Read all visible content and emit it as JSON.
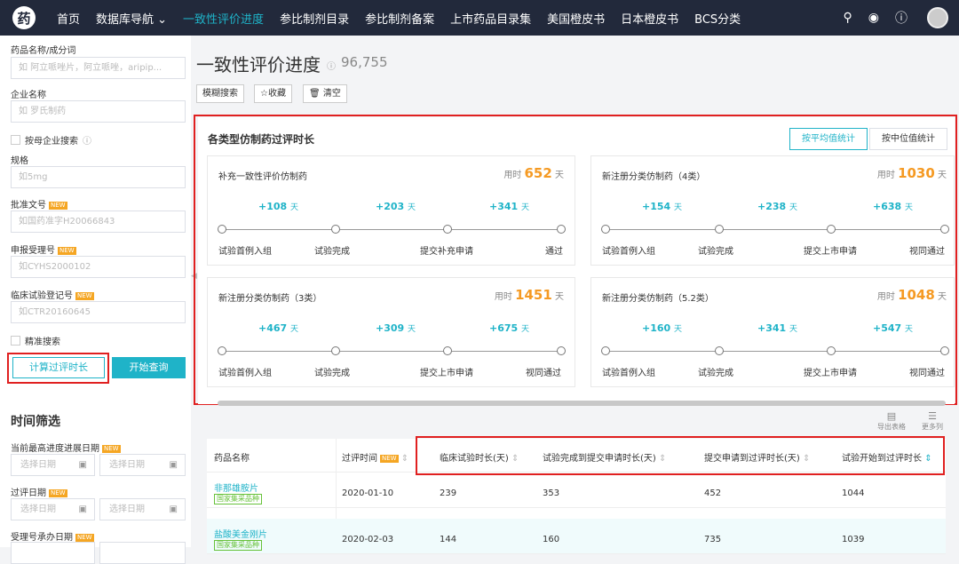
{
  "topbar": {
    "logo": "药",
    "nav": [
      "首页",
      "数据库导航 ⌄",
      "一致性评价进度",
      "参比制剂目录",
      "参比制剂备案",
      "上市药品目录集",
      "美国橙皮书",
      "日本橙皮书",
      "BCS分类"
    ],
    "active_index": 2,
    "icons": [
      "search-icon",
      "bulb-icon",
      "help-icon"
    ]
  },
  "sidebar": {
    "drug_label": "药品名称/成分词",
    "drug_placeholder": "如 阿立哌唑片，阿立哌唑，aripip...",
    "company_label": "企业名称",
    "company_placeholder": "如 罗氏制药",
    "parent_search": "按母企业搜索",
    "spec_label": "规格",
    "spec_placeholder": "如5mg",
    "approval_label": "批准文号",
    "approval_placeholder": "如国药准字H20066843",
    "apply_label": "申报受理号",
    "apply_placeholder": "如CYHS2000102",
    "trial_label": "临床试验登记号",
    "trial_placeholder": "如CTR20160645",
    "new_tag": "NEW",
    "exact_search": "精准搜索",
    "calc_button": "计算过评时长",
    "search_button": "开始查询",
    "time_filter": "时间筛选",
    "latest_date_label": "当前最高进度进展日期",
    "eval_date_label": "过评日期",
    "accept_date_label": "受理号承办日期",
    "date_placeholder": "选择日期"
  },
  "main": {
    "title": "一致性评价进度",
    "count": "96,755",
    "fuzzy": "模糊搜索",
    "favorite": "☆收藏",
    "clear": "🗑 清空"
  },
  "panel": {
    "title": "各类型仿制药过评时长",
    "tab_avg": "按平均值统计",
    "tab_median": "按中位值统计",
    "time_prefix": "用时",
    "day": "天",
    "cards": [
      {
        "title": "补充一致性评价仿制药",
        "days": "652",
        "deltas": [
          "+108",
          "+203",
          "+341"
        ],
        "steps": [
          "试验首例入组",
          "试验完成",
          "提交补充申请",
          "通过"
        ]
      },
      {
        "title": "新注册分类仿制药（4类）",
        "days": "1030",
        "deltas": [
          "+154",
          "+238",
          "+638"
        ],
        "steps": [
          "试验首例入组",
          "试验完成",
          "提交上市申请",
          "视同通过"
        ]
      },
      {
        "title": "新注册分类仿制药（3类）",
        "days": "1451",
        "deltas": [
          "+467",
          "+309",
          "+675"
        ],
        "steps": [
          "试验首例入组",
          "试验完成",
          "提交上市申请",
          "视同通过"
        ]
      },
      {
        "title": "新注册分类仿制药（5.2类）",
        "days": "1048",
        "deltas": [
          "+160",
          "+341",
          "+547"
        ],
        "steps": [
          "试验首例入组",
          "试验完成",
          "提交上市申请",
          "视同通过"
        ]
      }
    ]
  },
  "tools": {
    "export": "导出表格",
    "more": "更多列"
  },
  "table": {
    "headers": [
      "药品名称",
      "过评时间",
      "临床试验时长(天)",
      "试验完成到提交申请时长(天)",
      "提交申请到过评时长(天)",
      "试验开始到过评时长"
    ],
    "rows": [
      {
        "name": "非那雄胺片",
        "tag": "国家集采品种",
        "date": "2020-01-10",
        "v1": "239",
        "v2": "353",
        "v3": "452",
        "v4": "1044"
      },
      {
        "name": "盐酸美金刚片",
        "tag": "国家集采品种",
        "date": "2020-02-03",
        "v1": "144",
        "v2": "160",
        "v3": "735",
        "v4": "1039"
      }
    ]
  }
}
